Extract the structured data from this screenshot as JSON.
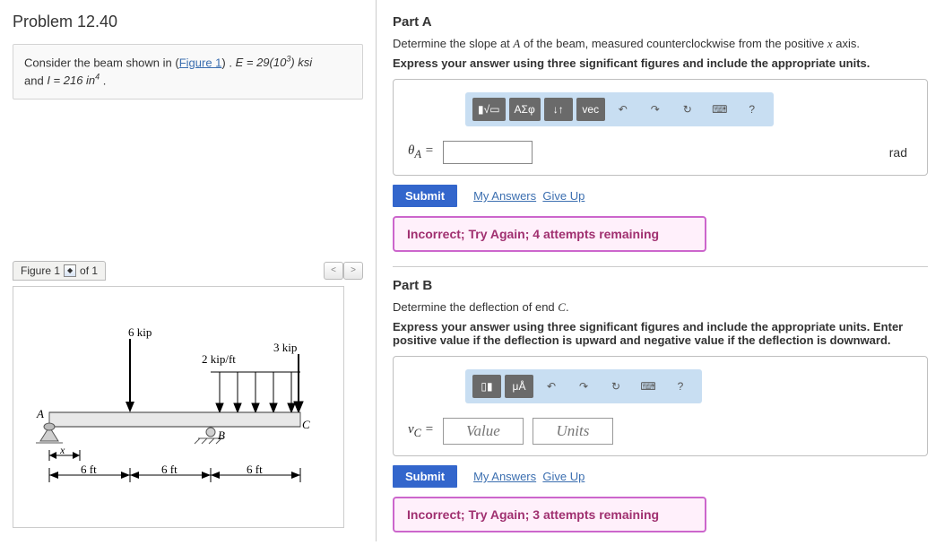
{
  "problem_title": "Problem 12.40",
  "consider": {
    "pre": "Consider the beam shown in (",
    "fig_link": "Figure 1",
    "post": ") . ",
    "E_expr": "E = 29(10",
    "E_sup": "3",
    "E_post": ") ksi",
    "and": "and ",
    "I_expr": "I = 216  in",
    "I_sup": "4",
    "period": " ."
  },
  "figbar": {
    "label": "Figure 1",
    "of": "of 1",
    "prev": "<",
    "next": ">"
  },
  "beam": {
    "load_point": "6 kip",
    "load_dist": "2 kip/ft",
    "load_end": "3 kip",
    "A": "A",
    "B": "B",
    "C": "C",
    "x": "x",
    "d1": "6 ft",
    "d2": "6 ft",
    "d3": "6 ft"
  },
  "partA": {
    "title": "Part A",
    "desc_pre": "Determine the slope at ",
    "desc_var": "A",
    "desc_post": " of the beam, measured counterclockwise from the positive ",
    "desc_var2": "x",
    "desc_end": " axis.",
    "instr": "Express your answer using three significant figures and include the appropriate units.",
    "toolbar": {
      "tmpl": "▮√▭",
      "greek": "ΑΣφ",
      "arrows": "↓↑",
      "vec": "vec",
      "undo": "↶",
      "redo": "↷",
      "reset": "↻",
      "kb": "⌨",
      "help": "?"
    },
    "label": "θ",
    "sub": "A",
    "eq": " = ",
    "unit": "rad",
    "submit": "Submit",
    "myans": "My Answers",
    "giveup": "Give Up",
    "feedback": "Incorrect; Try Again; 4 attempts remaining"
  },
  "partB": {
    "title": "Part B",
    "desc_pre": "Determine the deflection of end ",
    "desc_var": "C",
    "desc_post": ".",
    "instr": "Express your answer using three significant figures and include the appropriate units. Enter positive value if the deflection is upward and negative value if the deflection is downward.",
    "toolbar": {
      "tmpl": "▯▮",
      "units": "μÅ",
      "undo": "↶",
      "redo": "↷",
      "reset": "↻",
      "kb": "⌨",
      "help": "?"
    },
    "label": "v",
    "sub": "C",
    "eq": " = ",
    "value_ph": "Value",
    "units_ph": "Units",
    "submit": "Submit",
    "myans": "My Answers",
    "giveup": "Give Up",
    "feedback": "Incorrect; Try Again; 3 attempts remaining"
  }
}
